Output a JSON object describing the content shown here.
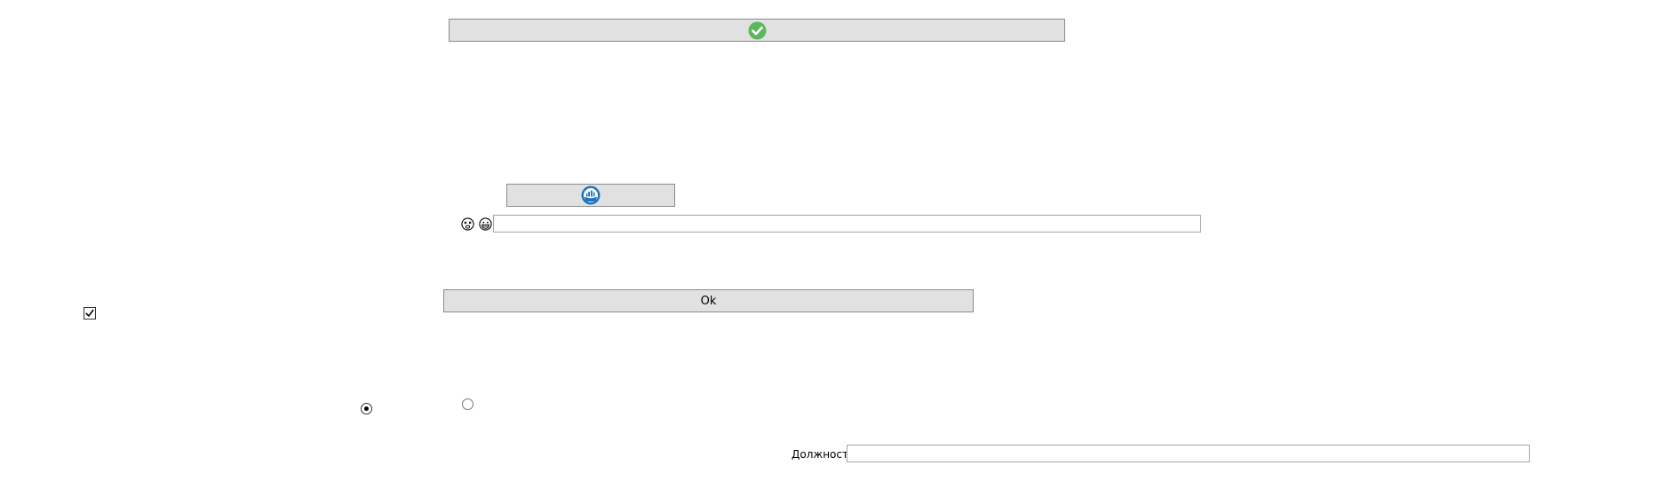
{
  "top_button": {
    "icon": "check-circle-icon",
    "icon_color": "#5cb85c"
  },
  "mid_button": {
    "icon": "ship-badge-icon",
    "icon_color": "#1e73be"
  },
  "emoji_row": {
    "icons": [
      "dizzy-face-icon",
      "grinning-face-icon"
    ],
    "input_value": ""
  },
  "ok_button": {
    "label": "Ok"
  },
  "checkbox": {
    "checked": true
  },
  "radios": [
    {
      "checked": true
    },
    {
      "checked": false
    }
  ],
  "position_field": {
    "label": "Должность",
    "value": ""
  }
}
